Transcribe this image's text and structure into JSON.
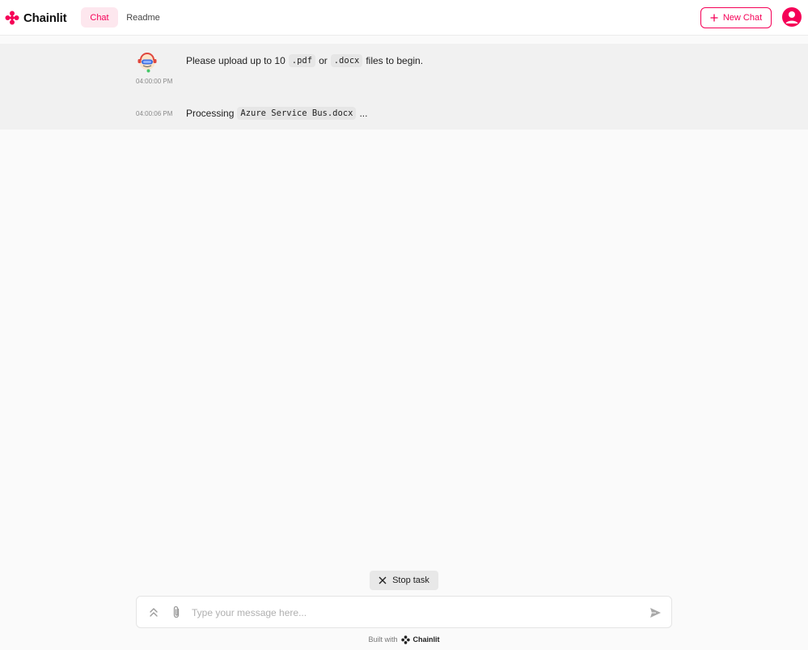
{
  "header": {
    "brand": "Chainlit",
    "tabs": [
      {
        "label": "Chat",
        "active": true
      },
      {
        "label": "Readme",
        "active": false
      }
    ],
    "new_chat_label": "New Chat",
    "accent_color": "#f50057"
  },
  "messages": [
    {
      "author": "bot",
      "time": "04:00:00 PM",
      "parts": [
        "Please upload up to 10",
        ".pdf",
        "or",
        ".docx",
        "files to begin."
      ]
    },
    {
      "author": "bot",
      "time": "04:00:06 PM",
      "parts": [
        "Processing",
        "Azure Service Bus.docx",
        "..."
      ]
    }
  ],
  "stop_task_label": "Stop task",
  "composer": {
    "placeholder": "Type your message here...",
    "value": ""
  },
  "footer": {
    "built_with": "Built with",
    "brand": "Chainlit"
  }
}
